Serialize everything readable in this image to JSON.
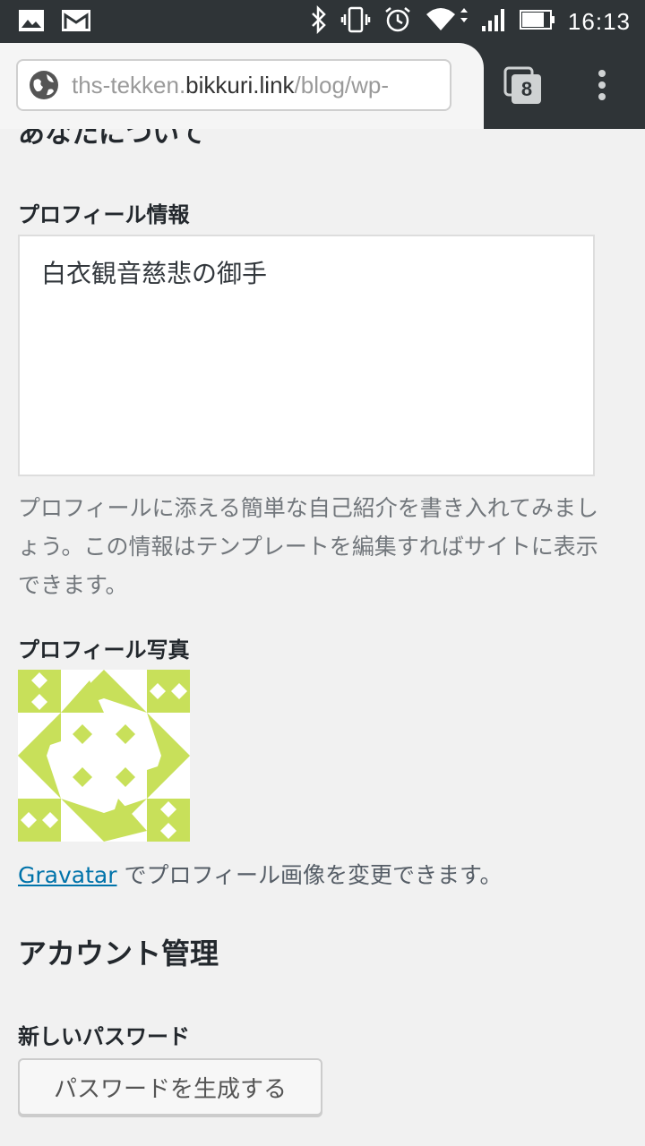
{
  "status_bar": {
    "time": "16:13",
    "icons": [
      "image-icon",
      "gmail-icon",
      "bluetooth-icon",
      "vibrate-icon",
      "alarm-icon",
      "wifi-icon",
      "signal-icon",
      "battery-icon"
    ]
  },
  "browser": {
    "url_prefix": "ths-tekken.",
    "url_host": "bikkuri.link",
    "url_suffix": "/blog/wp-",
    "tab_count": "8"
  },
  "page": {
    "partial_section_title": "あなたについて",
    "profile_info_label": "プロフィール情報",
    "profile_info_value": "白衣観音慈悲の御手",
    "profile_info_desc": "プロフィールに添える簡単な自己紹介を書き入れてみましょう。この情報はテンプレートを編集すればサイトに表示できます。",
    "profile_photo_label": "プロフィール写真",
    "gravatar_link": "Gravatar",
    "gravatar_text": " でプロフィール画像を変更できます。",
    "account_heading": "アカウント管理",
    "new_password_label": "新しいパスワード",
    "generate_password_button": "パスワードを生成する"
  },
  "colors": {
    "identicon": "#c8e05a",
    "link": "#0073aa",
    "background": "#f1f1f1"
  }
}
